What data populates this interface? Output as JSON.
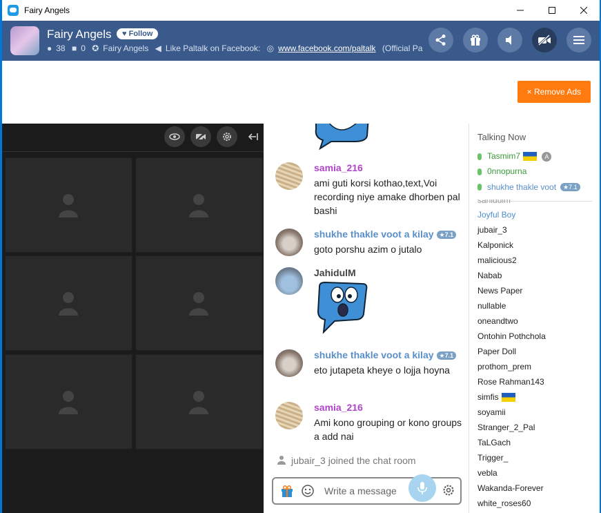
{
  "window": {
    "title": "Fairy Angels"
  },
  "room": {
    "name": "Fairy Angels",
    "follow_label": "Follow",
    "users_count": "38",
    "cams_count": "0",
    "owner": "Fairy Angels",
    "promo_text": "Like Paltalk on Facebook:",
    "promo_link": "www.facebook.com/paltalk",
    "promo_suffix": "(Official Pa"
  },
  "ads": {
    "remove_label": "× Remove Ads",
    "accent": "#ff7b0f"
  },
  "chat": {
    "messages": [
      {
        "name": "samia_216",
        "name_color": "#b044c8",
        "text": "ami guti korsi kothao,text,Voi recording niye amake dhorben pal bashi"
      },
      {
        "name": "shukhe thakle voot a kilay",
        "name_color": "#5a8fc8",
        "badge": "7.1",
        "text": "goto porshu azim o jutalo"
      },
      {
        "name": "JahidulM",
        "name_color": "#444444",
        "text": ""
      },
      {
        "name": "shukhe thakle voot a kilay",
        "name_color": "#5a8fc8",
        "badge": "7.1",
        "text": "eto jutapeta kheye o lojja hoyna"
      },
      {
        "name": "samia_216",
        "name_color": "#b044c8",
        "text": "Ami kono grouping or kono groups a add nai"
      }
    ],
    "joined_notice": "jubair_3 joined the chat room",
    "input_placeholder": "Write a message"
  },
  "users": {
    "heading": "Talking Now",
    "talking": [
      {
        "name": "Tasmim7",
        "flag": "ukraine",
        "extra": "A"
      },
      {
        "name": "0nnopurna"
      },
      {
        "name": "shukhe thakle voot a kilay",
        "badge": "7.1"
      }
    ],
    "list": [
      {
        "name": "sahidulm"
      },
      {
        "name": "Joyful Boy",
        "color": "#4a8fd0"
      },
      {
        "name": "jubair_3"
      },
      {
        "name": "Kalponick"
      },
      {
        "name": "malicious2"
      },
      {
        "name": "Nabab"
      },
      {
        "name": "News Paper"
      },
      {
        "name": "nullable"
      },
      {
        "name": "oneandtwo"
      },
      {
        "name": "Ontohin Pothchola"
      },
      {
        "name": "Paper Doll"
      },
      {
        "name": "prothom_prem"
      },
      {
        "name": "Rose Rahman143"
      },
      {
        "name": "simfis",
        "flag": "ukraine"
      },
      {
        "name": "soyamii"
      },
      {
        "name": "Stranger_2_Pal"
      },
      {
        "name": "TaLGach"
      },
      {
        "name": "Trigger_"
      },
      {
        "name": "vebla"
      },
      {
        "name": "Wakanda-Forever"
      },
      {
        "name": "white_roses60"
      }
    ]
  }
}
